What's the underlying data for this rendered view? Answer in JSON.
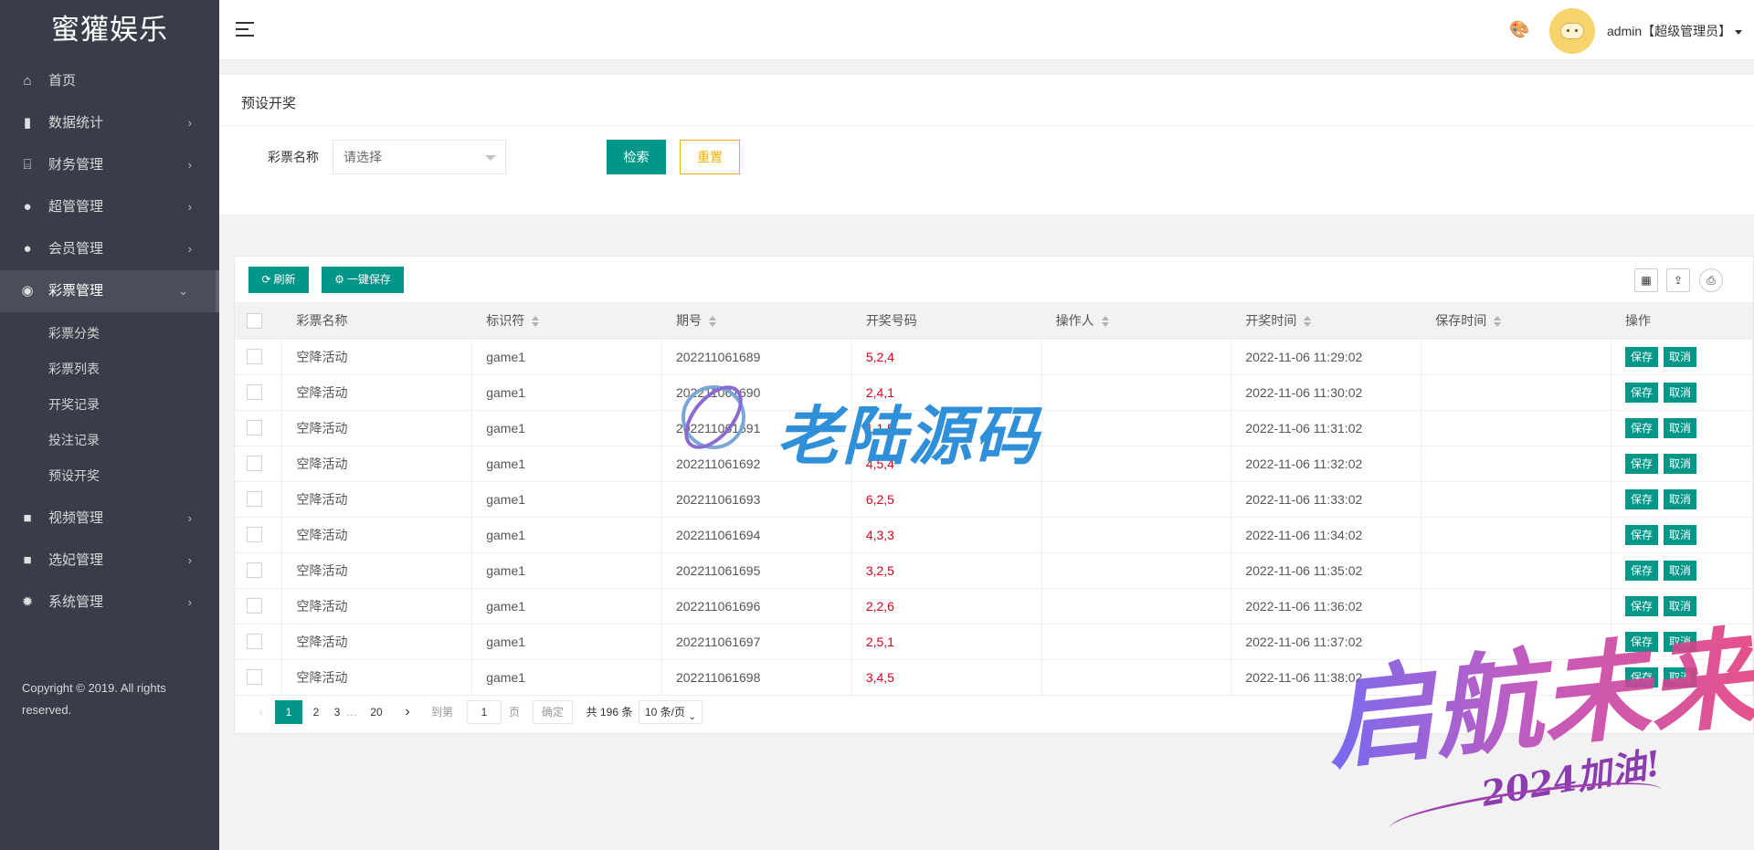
{
  "app": {
    "logo": "蜜獾娱乐"
  },
  "sidebar": {
    "items": [
      {
        "label": "首页",
        "icon": "home-icon",
        "glyph": "⌂",
        "has_children": false
      },
      {
        "label": "数据统计",
        "icon": "bar-chart-icon",
        "glyph": "▮",
        "has_children": true
      },
      {
        "label": "财务管理",
        "icon": "bank-icon",
        "glyph": "⌸",
        "has_children": true
      },
      {
        "label": "超管管理",
        "icon": "user-icon",
        "glyph": "●",
        "has_children": true
      },
      {
        "label": "会员管理",
        "icon": "users-icon",
        "glyph": "●",
        "has_children": true
      },
      {
        "label": "彩票管理",
        "icon": "gamepad-icon",
        "glyph": "◉",
        "has_children": true,
        "expanded": true
      }
    ],
    "lottery_sub": [
      "彩票分类",
      "彩票列表",
      "开奖记录",
      "投注记录",
      "预设开奖"
    ],
    "items_after": [
      {
        "label": "视频管理",
        "icon": "video-icon",
        "glyph": "■",
        "has_children": true
      },
      {
        "label": "选妃管理",
        "icon": "video-icon",
        "glyph": "■",
        "has_children": true
      },
      {
        "label": "系统管理",
        "icon": "gear-icon",
        "glyph": "✹",
        "has_children": true
      }
    ],
    "copyright": "Copyright © 2019. All rights reserved."
  },
  "header": {
    "user": "admin【超级管理员】"
  },
  "search": {
    "title": "预设开奖",
    "field_label": "彩票名称",
    "select_placeholder": "请选择",
    "search_label": "检索",
    "reset_label": "重置"
  },
  "toolbar": {
    "refresh_label": "刷新",
    "save_all_label": "一键保存"
  },
  "table": {
    "headers": [
      "彩票名称",
      "标识符",
      "期号",
      "开奖号码",
      "操作人",
      "开奖时间",
      "保存时间",
      "操作"
    ],
    "save_label": "保存",
    "cancel_label": "取消",
    "rows": [
      {
        "name": "空降活动",
        "key": "game1",
        "issue": "202211061689",
        "number": "5,2,4",
        "operator": "",
        "open_time": "2022-11-06 11:29:02",
        "save_time": ""
      },
      {
        "name": "空降活动",
        "key": "game1",
        "issue": "202211061690",
        "number": "2,4,1",
        "operator": "",
        "open_time": "2022-11-06 11:30:02",
        "save_time": ""
      },
      {
        "name": "空降活动",
        "key": "game1",
        "issue": "202211061691",
        "number": "1,1,5",
        "operator": "",
        "open_time": "2022-11-06 11:31:02",
        "save_time": ""
      },
      {
        "name": "空降活动",
        "key": "game1",
        "issue": "202211061692",
        "number": "4,5,4",
        "operator": "",
        "open_time": "2022-11-06 11:32:02",
        "save_time": ""
      },
      {
        "name": "空降活动",
        "key": "game1",
        "issue": "202211061693",
        "number": "6,2,5",
        "operator": "",
        "open_time": "2022-11-06 11:33:02",
        "save_time": ""
      },
      {
        "name": "空降活动",
        "key": "game1",
        "issue": "202211061694",
        "number": "4,3,3",
        "operator": "",
        "open_time": "2022-11-06 11:34:02",
        "save_time": ""
      },
      {
        "name": "空降活动",
        "key": "game1",
        "issue": "202211061695",
        "number": "3,2,5",
        "operator": "",
        "open_time": "2022-11-06 11:35:02",
        "save_time": ""
      },
      {
        "name": "空降活动",
        "key": "game1",
        "issue": "202211061696",
        "number": "2,2,6",
        "operator": "",
        "open_time": "2022-11-06 11:36:02",
        "save_time": ""
      },
      {
        "name": "空降活动",
        "key": "game1",
        "issue": "202211061697",
        "number": "2,5,1",
        "operator": "",
        "open_time": "2022-11-06 11:37:02",
        "save_time": ""
      },
      {
        "name": "空降活动",
        "key": "game1",
        "issue": "202211061698",
        "number": "3,4,5",
        "operator": "",
        "open_time": "2022-11-06 11:38:02",
        "save_time": ""
      }
    ]
  },
  "pagination": {
    "current": "1",
    "pages": [
      "2",
      "3"
    ],
    "ellipsis": "…",
    "last": "20",
    "goto_label": "到第",
    "goto_value": "1",
    "page_unit": "页",
    "confirm_label": "确定",
    "total": "共 196 条",
    "page_size": "10 条/页"
  },
  "watermarks": {
    "center": "老陆源码",
    "corner": "启航未来",
    "corner_sub": "2024加油!"
  },
  "colors": {
    "sidebar_bg": "#393d49",
    "accent": "#009688",
    "warn": "#f0b400",
    "number": "#d9001b"
  }
}
